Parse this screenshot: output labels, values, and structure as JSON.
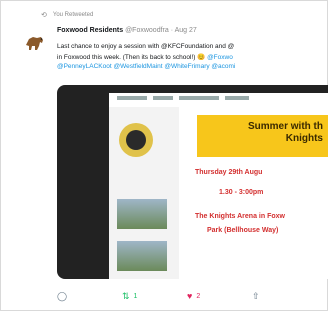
{
  "tweet": {
    "retweeted_by": "You Retweeted",
    "author_name": "Foxwood Residents",
    "author_handle": "@Foxwoodfra · Aug 27",
    "text_line1": "Last chance to enjoy a session with @KFCFoundation and @",
    "text_line2": "in Foxwood this week. (Then its back to school!)",
    "text_line2_link": " @Foxwo",
    "text_line3": "@PenneyLACKoot  @WestfieldMaint  @WhiteFrimary  @acomi"
  },
  "poster": {
    "title_line1": "Summer with th",
    "title_line2": "Knights",
    "date": "Thursday 29th Augu",
    "time": "1.30 - 3:00pm",
    "venue_line1": "The Knights Arena in Foxw",
    "venue_line2": "Park (Bellhouse Way)"
  },
  "actions": {
    "reply_count": "",
    "retweet_count": "1",
    "like_count": "2"
  },
  "colors": {
    "link": "#1b95e0",
    "retweet_green": "#17bf63",
    "like_red": "#e0245e",
    "poster_yellow": "#f7c61b",
    "poster_red": "#d32f2f"
  },
  "icons": {
    "retweet_header": "retweet-icon",
    "reply": "reply-icon",
    "retweet": "retweet-icon",
    "like": "heart-icon",
    "share": "share-icon"
  }
}
